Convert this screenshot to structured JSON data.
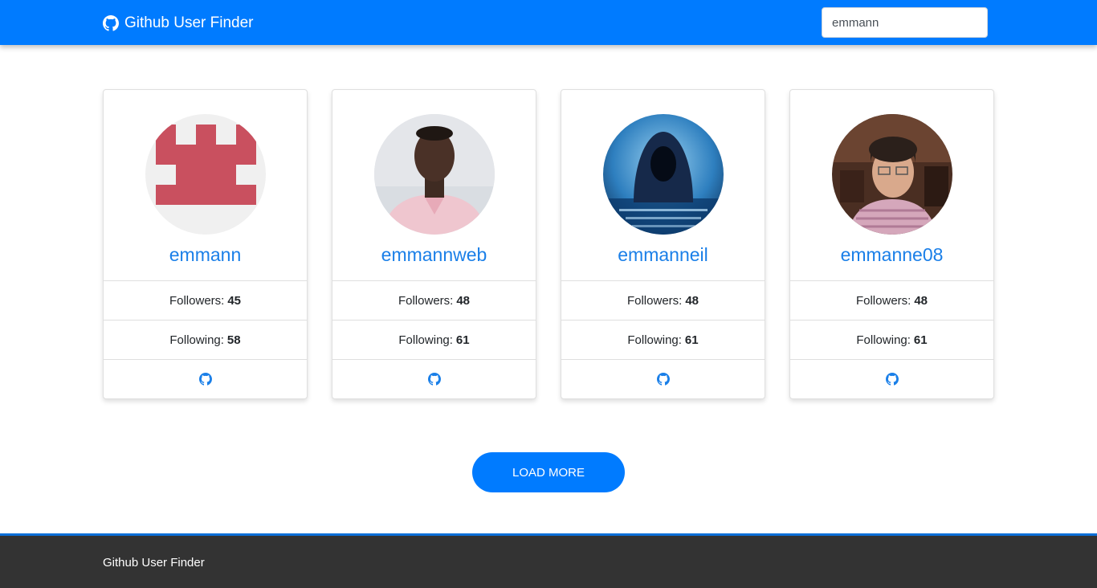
{
  "navbar": {
    "brand_icon": "github-icon",
    "brand": "Github User Finder",
    "search_value": "emmann"
  },
  "users": [
    {
      "login": "emmann",
      "followers_label": "Followers:",
      "followers": "45",
      "following_label": "Following:",
      "following": "58",
      "avatar": "identicon-avatar",
      "link_icon": "github-icon"
    },
    {
      "login": "emmannweb",
      "followers_label": "Followers:",
      "followers": "48",
      "following_label": "Following:",
      "following": "61",
      "avatar": "photo-avatar",
      "link_icon": "github-icon"
    },
    {
      "login": "emmanneil",
      "followers_label": "Followers:",
      "followers": "48",
      "following_label": "Following:",
      "following": "61",
      "avatar": "hacker-avatar",
      "link_icon": "github-icon"
    },
    {
      "login": "emmanne08",
      "followers_label": "Followers:",
      "followers": "48",
      "following_label": "Following:",
      "following": "61",
      "avatar": "photo-avatar",
      "link_icon": "github-icon"
    }
  ],
  "load_more": "LOAD MORE",
  "footer": {
    "text": "Github User Finder"
  },
  "colors": {
    "primary": "#007bff",
    "link": "#1a7fe8",
    "footer_bg": "#333333",
    "identicon": "#c9505f"
  }
}
